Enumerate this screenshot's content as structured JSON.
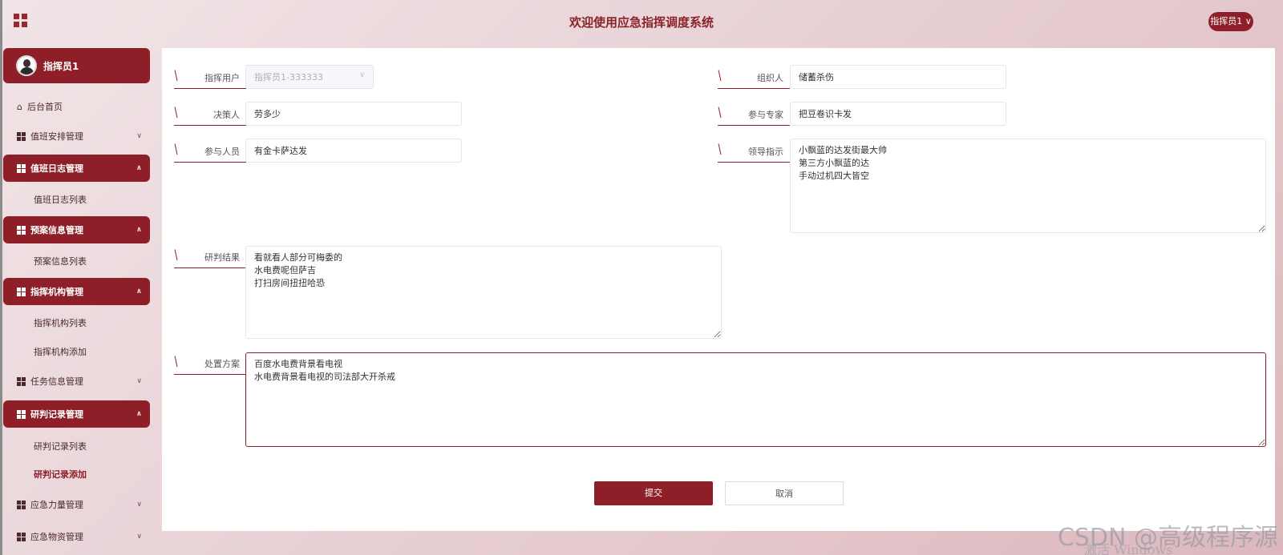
{
  "header": {
    "title": "欢迎使用应急指挥调度系统",
    "user_menu": "指挥员1 ∨"
  },
  "sidebar": {
    "profile_name": "指挥员1",
    "items": [
      {
        "label": "后台首页"
      },
      {
        "label": "值班安排管理"
      },
      {
        "label": "值班日志管理"
      },
      {
        "label": "值班日志列表"
      },
      {
        "label": "预案信息管理"
      },
      {
        "label": "预案信息列表"
      },
      {
        "label": "指挥机构管理"
      },
      {
        "label": "指挥机构列表"
      },
      {
        "label": "指挥机构添加"
      },
      {
        "label": "任务信息管理"
      },
      {
        "label": "研判记录管理"
      },
      {
        "label": "研判记录列表"
      },
      {
        "label": "研判记录添加"
      },
      {
        "label": "应急力量管理"
      },
      {
        "label": "应急物资管理"
      }
    ]
  },
  "form": {
    "commander_label": "指挥用户",
    "commander_value": "指挥员1-333333",
    "organizer_label": "组织人",
    "organizer_value": "储蓄杀伤",
    "decision_label": "决策人",
    "decision_value": "劳多少",
    "expert_label": "参与专家",
    "expert_value": "把豆卷识卡发",
    "participant_label": "参与人员",
    "participant_value": "有金卡萨达发",
    "instruction_label": "领导指示",
    "instruction_value": "小飘蓝的达发街最大帅\n第三方小飘蓝的达\n手动过机四大皆空",
    "result_label": "研判结果",
    "result_value": "看就看人部分可梅委的\n水电费呢但萨吉\n打扫房间扭扭哈恐",
    "plan_label": "处置方案",
    "plan_value": "百度水电费背景看电视\n水电费背景看电视的司法部大开杀戒",
    "submit_label": "提交",
    "cancel_label": "取消"
  },
  "overlay": {
    "watermark": "CSDN @高级程序源",
    "activate": "激活 Windows"
  },
  "colors": {
    "brand": "#8e1f28",
    "title": "#8b2229"
  }
}
